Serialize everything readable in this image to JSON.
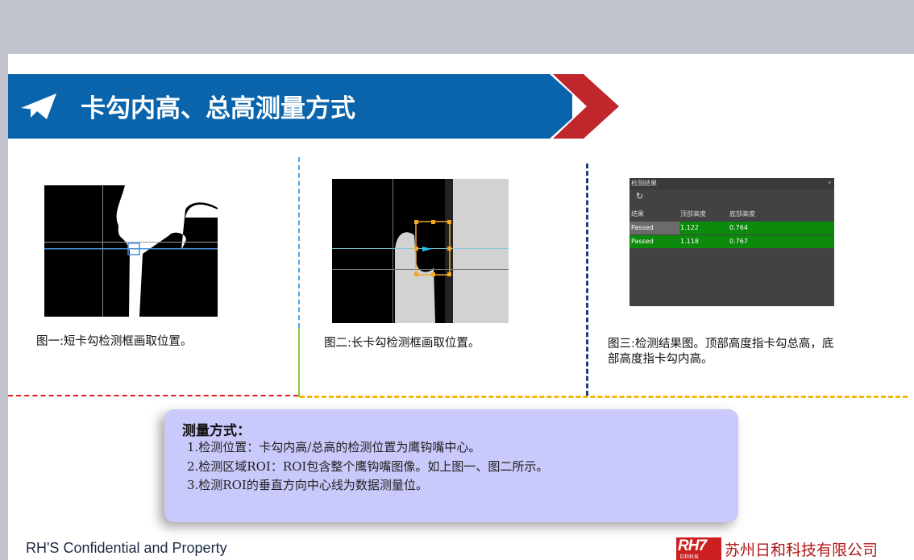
{
  "title": "卡勾内高、总高测量方式",
  "figures": [
    {
      "caption": "图一:短卡勾检测框画取位置。"
    },
    {
      "caption": "图二:长卡勾检测框画取位置。"
    },
    {
      "caption_line1": "图三:检测结果图。顶部高度指卡勾总高，底",
      "caption_line2": "部高度指卡勾内高。"
    }
  ],
  "result_panel": {
    "header": "检测结果",
    "columns": [
      "结果",
      "顶部高度",
      "底部高度"
    ],
    "rows": [
      {
        "result": "Passed",
        "top": "1.122",
        "bottom": "0.764"
      },
      {
        "result": "Passed",
        "top": "1.118",
        "bottom": "0.767"
      }
    ]
  },
  "method": {
    "title": "测量方式：",
    "items": [
      "1.检测位置：卡勾内高/总高的检测位置为鹰钩嘴中心。",
      "2.检测区域ROI：ROI包含整个鹰钩嘴图像。如上图一、图二所示。",
      "3.检测ROI的垂直方向中心线为数据测量位。"
    ]
  },
  "footer": {
    "left": "RH'S Confidential and Property",
    "logo": "RH7",
    "logo_sub": "日和科技",
    "company": "苏州日和科技有限公司"
  },
  "colors": {
    "banner": "#0a64ab",
    "arrow": "#c0272d",
    "info_bg": "#c9c9fb",
    "pass_green": "#0b8a0b"
  }
}
